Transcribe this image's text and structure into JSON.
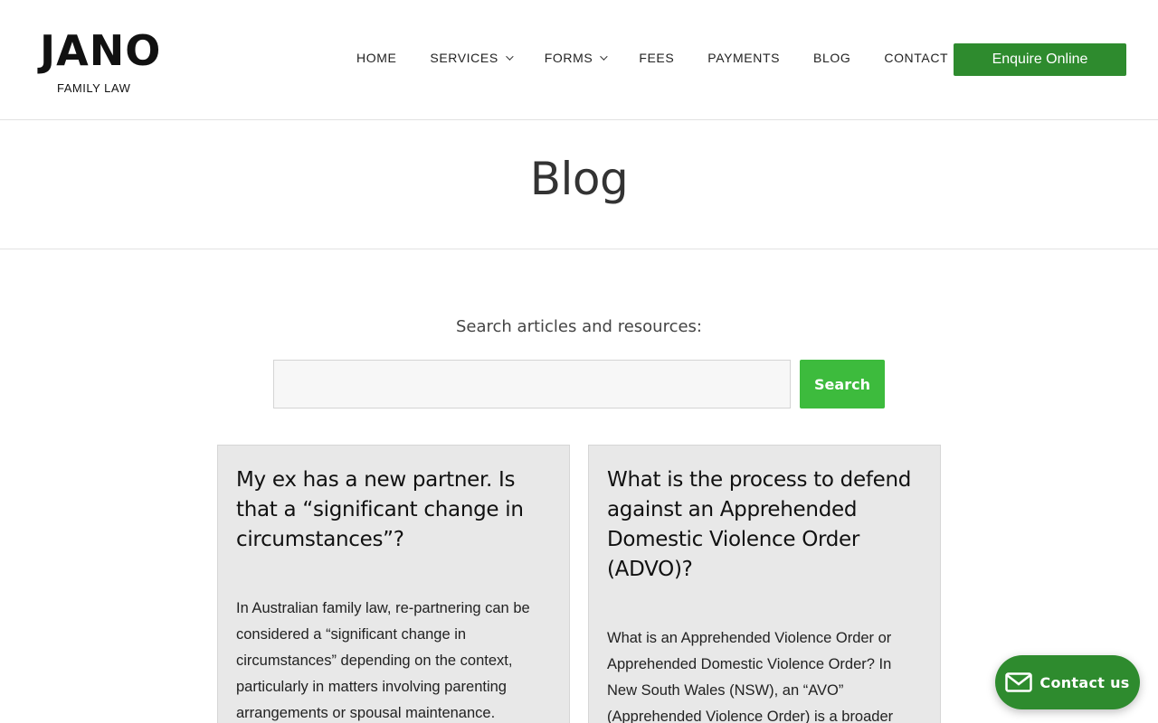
{
  "header": {
    "logo": {
      "mark": "JANO",
      "subtitle": "FAMILY LAW"
    },
    "nav": [
      {
        "label": "HOME",
        "has_dropdown": false
      },
      {
        "label": "SERVICES",
        "has_dropdown": true
      },
      {
        "label": "FORMS",
        "has_dropdown": true
      },
      {
        "label": "FEES",
        "has_dropdown": false
      },
      {
        "label": "PAYMENTS",
        "has_dropdown": false
      },
      {
        "label": "BLOG",
        "has_dropdown": false
      },
      {
        "label": "CONTACT",
        "has_dropdown": false
      }
    ],
    "cta_label": "Enquire Online"
  },
  "page": {
    "title": "Blog"
  },
  "search": {
    "label": "Search articles and resources:",
    "value": "",
    "button_label": "Search"
  },
  "posts": [
    {
      "title": "My ex has a new partner. Is that a “significant change in circumstances”?",
      "excerpt": "In Australian family law, re-partnering can be considered a “significant change in circumstances” depending on the context, particularly in matters involving parenting arrangements or spousal maintenance."
    },
    {
      "title": "What is the process to defend against an Apprehended Domestic Violence Order (ADVO)?",
      "excerpt": "What is an Apprehended Violence Order or Apprehended Domestic Violence Order? In New South Wales (NSW), an “AVO” (Apprehended Violence Order) is a broader"
    }
  ],
  "contact_widget": {
    "label": "Contact us",
    "icon": "envelope-icon"
  },
  "colors": {
    "brand_green": "#2e8b2e",
    "search_green": "#3dbb3d",
    "card_bg": "#e8e8e8"
  }
}
